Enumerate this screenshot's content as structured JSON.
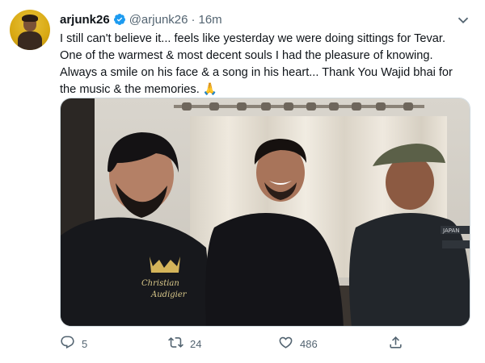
{
  "tweet": {
    "display_name": "arjunk26",
    "handle": "@arjunk26",
    "separator": "·",
    "time": "16m",
    "lines": [
      "I still can't believe it... feels like yesterday we were doing sittings for Tevar.",
      "One of the warmest & most decent souls I had the pleasure of knowing.",
      "Always a smile on his face & a song in his heart... Thank You Wajid bhai for",
      "the music & the memories. 🙏"
    ]
  },
  "photo": {
    "shirt_text_1": "Christian",
    "shirt_text_2": "Audigier",
    "cap_patch": "JAPAN"
  },
  "actions": {
    "reply_count": "5",
    "retweet_count": "24",
    "like_count": "486",
    "share_count": ""
  },
  "icons": {
    "verified": "verified-badge-icon",
    "more": "chevron-down-icon",
    "reply": "reply-icon",
    "retweet": "retweet-icon",
    "like": "heart-icon",
    "share": "share-icon"
  },
  "colors": {
    "text": "#0f1419",
    "secondary": "#536471",
    "verified": "#1d9bf0"
  }
}
